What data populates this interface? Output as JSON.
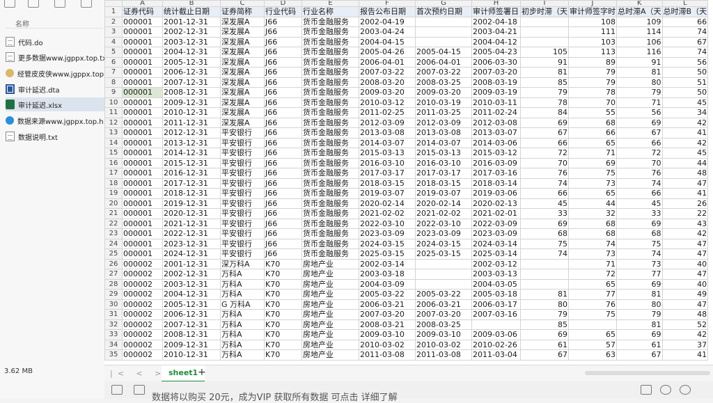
{
  "explorer": {
    "header": "名称",
    "files": [
      {
        "name": "代码.do",
        "icon": "doc-icon",
        "kind": "doc"
      },
      {
        "name": "更多数据www.jgppx.top.txt",
        "icon": "doc-icon",
        "kind": "doc"
      },
      {
        "name": "经管皮皮侠www.jgppx.top",
        "icon": "web-shortcut-icon",
        "kind": "web"
      },
      {
        "name": "审计延迟.dta",
        "icon": "dta-file-icon",
        "kind": "grid"
      },
      {
        "name": "审计延迟.xlsx",
        "icon": "excel-file-icon",
        "kind": "xls",
        "selected": true
      },
      {
        "name": "数据来源www.jgppx.top.h",
        "icon": "browser-link-icon",
        "kind": "edge"
      },
      {
        "name": "数据说明.txt",
        "icon": "doc-icon",
        "kind": "doc"
      }
    ],
    "size_status": "3.62 MB"
  },
  "sheet": {
    "column_letters": [
      "A",
      "B",
      "C",
      "D",
      "E",
      "F",
      "G",
      "H",
      "I",
      "J",
      "K",
      "L"
    ],
    "headers": [
      "证券代码",
      "统计截止日期",
      "证券简称",
      "行业代码",
      "行业名称",
      "报告公布日期",
      "首次预约日期",
      "审计师签署日",
      "初步时滞（天",
      "审计师签字时",
      "总时滞A（天",
      "总时滞B（天"
    ],
    "rows": [
      [
        "000001",
        "2001-12-31",
        "深发展A",
        "J66",
        "货币金融服务",
        "2002-04-19",
        "",
        "2002-04-18",
        "",
        "108",
        "109",
        "66"
      ],
      [
        "000001",
        "2002-12-31",
        "深发展A",
        "J66",
        "货币金融服务",
        "2003-04-24",
        "",
        "2003-04-21",
        "",
        "111",
        "114",
        "74"
      ],
      [
        "000001",
        "2003-12-31",
        "深发展A",
        "J66",
        "货币金融服务",
        "2004-04-15",
        "",
        "2004-04-12",
        "",
        "103",
        "106",
        "67"
      ],
      [
        "000001",
        "2004-12-31",
        "深发展A",
        "J66",
        "货币金融服务",
        "2005-04-26",
        "2005-04-15",
        "2005-04-23",
        "105",
        "113",
        "116",
        "74"
      ],
      [
        "000001",
        "2005-12-31",
        "深发展A",
        "J66",
        "货币金融服务",
        "2006-04-01",
        "2006-04-01",
        "2006-03-30",
        "91",
        "89",
        "91",
        "56"
      ],
      [
        "000001",
        "2006-12-31",
        "深发展A",
        "J66",
        "货币金融服务",
        "2007-03-22",
        "2007-03-22",
        "2007-03-20",
        "81",
        "79",
        "81",
        "50"
      ],
      [
        "000001",
        "2007-12-31",
        "深发展A",
        "J66",
        "货币金融服务",
        "2008-03-20",
        "2008-03-25",
        "2008-03-19",
        "85",
        "79",
        "80",
        "51"
      ],
      [
        "000001",
        "2008-12-31",
        "深发展A",
        "J66",
        "货币金融服务",
        "2009-03-20",
        "2009-03-20",
        "2009-03-19",
        "79",
        "78",
        "79",
        "50"
      ],
      [
        "000001",
        "2009-12-31",
        "深发展A",
        "J66",
        "货币金融服务",
        "2010-03-12",
        "2010-03-19",
        "2010-03-11",
        "78",
        "70",
        "71",
        "45"
      ],
      [
        "000001",
        "2010-12-31",
        "深发展A",
        "J66",
        "货币金融服务",
        "2011-02-25",
        "2011-03-25",
        "2011-02-24",
        "84",
        "55",
        "56",
        "34"
      ],
      [
        "000001",
        "2011-12-31",
        "深发展A",
        "J66",
        "货币金融服务",
        "2012-03-09",
        "2012-03-09",
        "2012-03-08",
        "69",
        "68",
        "69",
        "42"
      ],
      [
        "000001",
        "2012-12-31",
        "平安银行",
        "J66",
        "货币金融服务",
        "2013-03-08",
        "2013-03-08",
        "2013-03-07",
        "67",
        "66",
        "67",
        "41"
      ],
      [
        "000001",
        "2013-12-31",
        "平安银行",
        "J66",
        "货币金融服务",
        "2014-03-07",
        "2014-03-07",
        "2014-03-06",
        "66",
        "65",
        "66",
        "42"
      ],
      [
        "000001",
        "2014-12-31",
        "平安银行",
        "J66",
        "货币金融服务",
        "2015-03-13",
        "2015-03-13",
        "2015-03-12",
        "72",
        "71",
        "72",
        "45"
      ],
      [
        "000001",
        "2015-12-31",
        "平安银行",
        "J66",
        "货币金融服务",
        "2016-03-10",
        "2016-03-10",
        "2016-03-09",
        "70",
        "69",
        "70",
        "44"
      ],
      [
        "000001",
        "2016-12-31",
        "平安银行",
        "J66",
        "货币金融服务",
        "2017-03-17",
        "2017-03-17",
        "2017-03-16",
        "76",
        "75",
        "76",
        "48"
      ],
      [
        "000001",
        "2017-12-31",
        "平安银行",
        "J66",
        "货币金融服务",
        "2018-03-15",
        "2018-03-15",
        "2018-03-14",
        "74",
        "73",
        "74",
        "47"
      ],
      [
        "000001",
        "2018-12-31",
        "平安银行",
        "J66",
        "货币金融服务",
        "2019-03-07",
        "2019-03-07",
        "2019-03-06",
        "66",
        "65",
        "66",
        "41"
      ],
      [
        "000001",
        "2019-12-31",
        "平安银行",
        "J66",
        "货币金融服务",
        "2020-02-14",
        "2020-02-14",
        "2020-02-13",
        "45",
        "44",
        "45",
        "26"
      ],
      [
        "000001",
        "2020-12-31",
        "平安银行",
        "J66",
        "货币金融服务",
        "2021-02-02",
        "2021-02-02",
        "2021-02-01",
        "33",
        "32",
        "33",
        "22"
      ],
      [
        "000001",
        "2021-12-31",
        "平安银行",
        "J66",
        "货币金融服务",
        "2022-03-10",
        "2022-03-10",
        "2022-03-09",
        "69",
        "68",
        "69",
        "43"
      ],
      [
        "000001",
        "2022-12-31",
        "平安银行",
        "J66",
        "货币金融服务",
        "2023-03-09",
        "2023-03-09",
        "2023-03-09",
        "68",
        "68",
        "68",
        "42"
      ],
      [
        "000001",
        "2023-12-31",
        "平安银行",
        "J66",
        "货币金融服务",
        "2024-03-15",
        "2024-03-15",
        "2024-03-14",
        "75",
        "74",
        "75",
        "47"
      ],
      [
        "000001",
        "2024-12-31",
        "平安银行",
        "J66",
        "货币金融服务",
        "2025-03-15",
        "2025-03-15",
        "2025-03-14",
        "74",
        "73",
        "74",
        "47"
      ],
      [
        "000002",
        "2001-12-31",
        "深万科A",
        "K70",
        "房地产业",
        "2002-03-14",
        "",
        "2002-03-12",
        "",
        "71",
        "73",
        "40"
      ],
      [
        "000002",
        "2002-12-31",
        "万科A",
        "K70",
        "房地产业",
        "2003-03-18",
        "",
        "2003-03-13",
        "",
        "72",
        "77",
        "47"
      ],
      [
        "000002",
        "2003-12-31",
        "万科A",
        "K70",
        "房地产业",
        "2004-03-09",
        "",
        "2004-03-05",
        "",
        "65",
        "69",
        "40"
      ],
      [
        "000002",
        "2004-12-31",
        "万科A",
        "K70",
        "房地产业",
        "2005-03-22",
        "2005-03-22",
        "2005-03-18",
        "81",
        "77",
        "81",
        "49"
      ],
      [
        "000002",
        "2005-12-31",
        "G 万科A",
        "K70",
        "房地产业",
        "2006-03-21",
        "2006-03-21",
        "2006-03-17",
        "80",
        "76",
        "80",
        "47"
      ],
      [
        "000002",
        "2006-12-31",
        "万科A",
        "K70",
        "房地产业",
        "2007-03-20",
        "2007-03-20",
        "2007-03-16",
        "79",
        "75",
        "79",
        "48"
      ],
      [
        "000002",
        "2007-12-31",
        "万科A",
        "K70",
        "房地产业",
        "2008-03-21",
        "2008-03-25",
        "",
        "85",
        "",
        "81",
        "52"
      ],
      [
        "000002",
        "2008-12-31",
        "万科A",
        "K70",
        "房地产业",
        "2009-03-10",
        "2009-03-10",
        "2009-03-06",
        "69",
        "65",
        "69",
        "42"
      ],
      [
        "000002",
        "2009-12-31",
        "万科A",
        "K70",
        "房地产业",
        "2010-03-02",
        "2010-03-02",
        "2010-02-26",
        "61",
        "57",
        "61",
        "37"
      ],
      [
        "000002",
        "2010-12-31",
        "万科A",
        "K70",
        "房地产业",
        "2011-03-08",
        "2011-03-08",
        "2011-03-04",
        "67",
        "63",
        "67",
        "41"
      ]
    ]
  },
  "statusbar": {
    "nav_arrows": "|< < > >|",
    "sheet_tab": "sheet1",
    "add_label": "+"
  },
  "ad_text": "数据将以购买 20元，成为VIP 获取所有数据 可点击 详细了解"
}
